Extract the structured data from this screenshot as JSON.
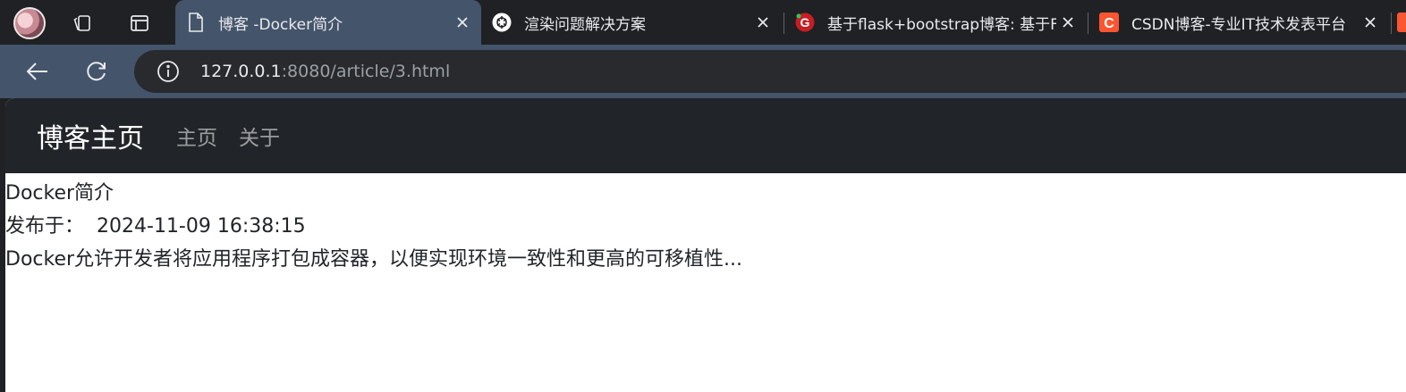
{
  "browser": {
    "tabs": [
      {
        "title": "博客 -Docker简介",
        "favicon": "file-icon",
        "active": true
      },
      {
        "title": "渲染问题解决方案",
        "favicon": "chatgpt-icon",
        "active": false
      },
      {
        "title": "基于flask+bootstrap博客: 基于F",
        "favicon": "gitee-icon",
        "active": false
      },
      {
        "title": "CSDN博客-专业IT技术发表平台",
        "favicon": "csdn-icon",
        "active": false
      }
    ],
    "address": {
      "host": "127.0.0.1",
      "rest": ":8080/article/3.html"
    }
  },
  "page": {
    "brand": "博客主页",
    "nav": [
      "主页",
      "关于"
    ],
    "article": {
      "title": "Docker简介",
      "published_label": "发布于：",
      "published_at": "2024-11-09 16:38:15",
      "summary": "Docker允许开发者将应用程序打包成容器，以便实现环境一致性和更高的可移植性..."
    }
  },
  "colors": {
    "tabbar": "#202124",
    "toolbar": "#44546a",
    "navbar": "#212529",
    "csdn": "#fc5531",
    "gitee": "#c71d23"
  }
}
